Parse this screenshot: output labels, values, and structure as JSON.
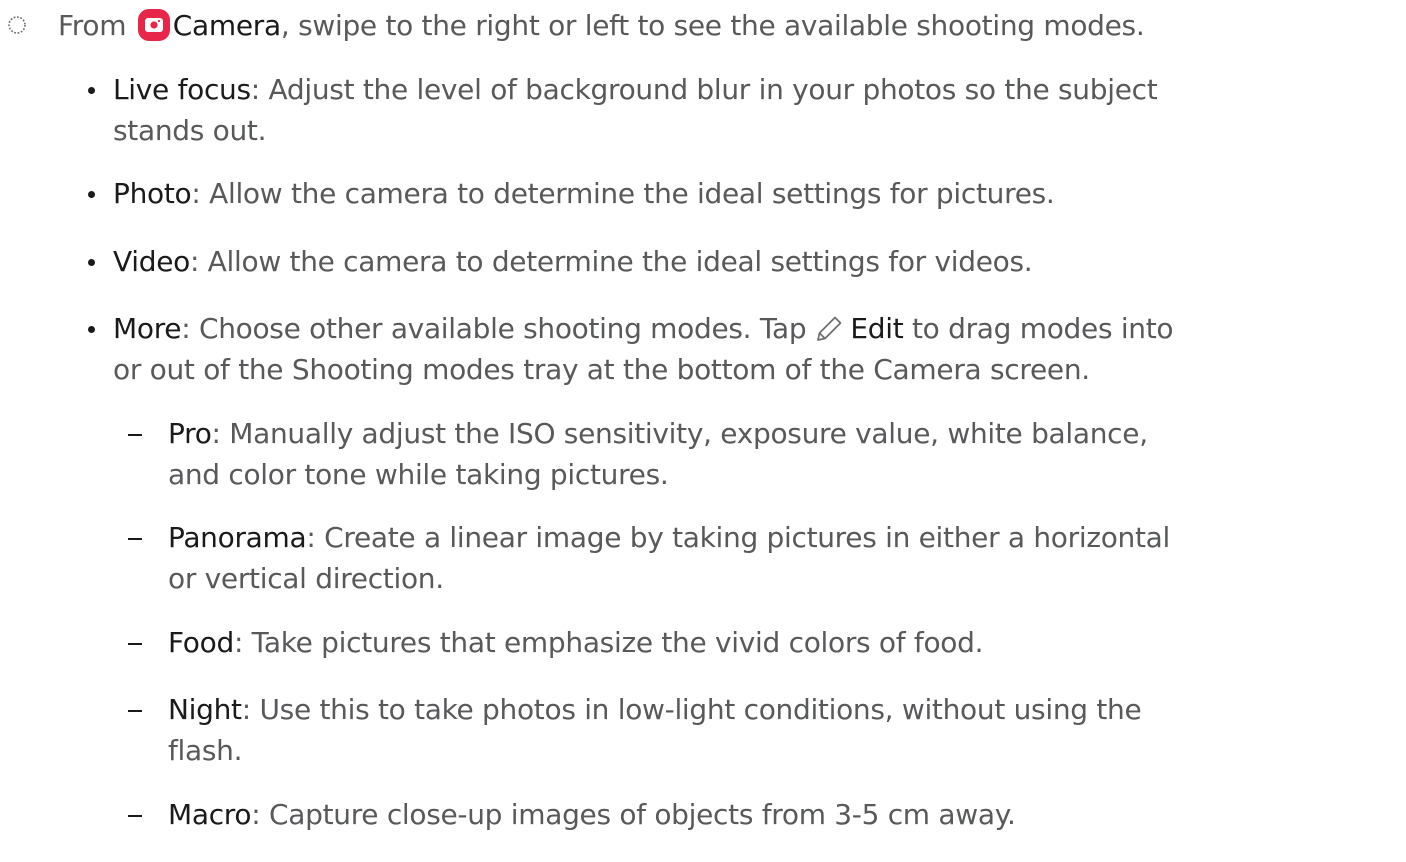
{
  "step": {
    "icon": "step-circle-icon",
    "prefix": "From",
    "app_icon": "camera-app-icon",
    "app_name": "Camera",
    "suffix": ", swipe to the right or left to see the available shooting modes."
  },
  "modes": [
    {
      "term": "Live focus",
      "line1": ": Adjust the level of background blur in your photos so the subject",
      "line2": "stands out."
    },
    {
      "term": "Photo",
      "line1": ": Allow the camera to determine the ideal settings for pictures."
    },
    {
      "term": "Video",
      "line1": ": Allow the camera to determine the ideal settings for videos."
    },
    {
      "term": "More",
      "line1_a": ": Choose other available shooting modes. Tap",
      "edit_icon": "pencil-icon",
      "edit_label": "Edit",
      "line1_b": " to drag modes into",
      "line2": "or out of the Shooting modes tray at the bottom of the Camera screen."
    }
  ],
  "sub_modes": [
    {
      "term": "Pro",
      "line1": ": Manually adjust the ISO sensitivity, exposure value, white balance,",
      "line2": "and color tone while taking pictures."
    },
    {
      "term": "Panorama",
      "line1": ": Create a linear image by taking pictures in either a horizontal",
      "line2": "or vertical direction."
    },
    {
      "term": "Food",
      "line1": ": Take pictures that emphasize the vivid colors of food."
    },
    {
      "term": "Night",
      "line1": ": Use this to take photos in low-light conditions, without using the",
      "line2": "flash."
    },
    {
      "term": "Macro",
      "line1": ": Capture close-up images of objects from 3-5 cm away."
    }
  ],
  "colors": {
    "text": "#58595b",
    "term": "#1a1a1a",
    "camera_icon": "#e8264a"
  }
}
